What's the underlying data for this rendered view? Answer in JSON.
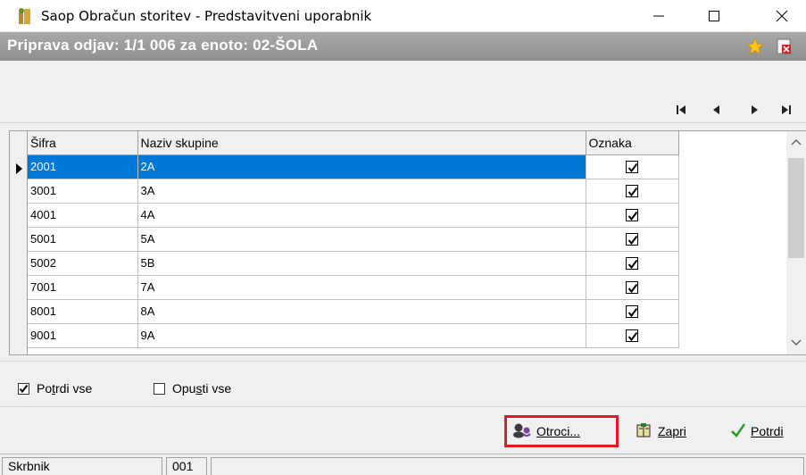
{
  "window": {
    "title": "Saop Obračun storitev - Predstavitveni uporabnik",
    "minimize_icon": "minimize-icon",
    "maximize_icon": "maximize-icon",
    "close_icon": "close-icon"
  },
  "header": {
    "title": "Priprava odjav: 1/1 006 za enoto: 02-ŠOLA",
    "favorite_icon": "star-icon",
    "exit_icon": "exit-icon"
  },
  "nav": {
    "first_icon": "first-record-icon",
    "prev_icon": "previous-record-icon",
    "next_icon": "next-record-icon",
    "last_icon": "last-record-icon"
  },
  "grid": {
    "columns": [
      "Šifra",
      "Naziv skupine",
      "Oznaka"
    ],
    "rows": [
      {
        "sifra": "2001",
        "naziv": "2A",
        "oznaka": true,
        "selected": true
      },
      {
        "sifra": "3001",
        "naziv": "3A",
        "oznaka": true
      },
      {
        "sifra": "4001",
        "naziv": "4A",
        "oznaka": true
      },
      {
        "sifra": "5001",
        "naziv": "5A",
        "oznaka": true
      },
      {
        "sifra": "5002",
        "naziv": "5B",
        "oznaka": true
      },
      {
        "sifra": "7001",
        "naziv": "7A",
        "oznaka": true
      },
      {
        "sifra": "8001",
        "naziv": "8A",
        "oznaka": true
      },
      {
        "sifra": "9001",
        "naziv": "9A",
        "oznaka": true
      }
    ]
  },
  "options": {
    "potrdi_vse": {
      "pre": "Po",
      "acc": "t",
      "post": "rdi vse",
      "checked": true
    },
    "opusti_vse": {
      "pre": "Opu",
      "acc": "s",
      "post": "ti vse",
      "checked": false
    }
  },
  "buttons": {
    "otroci": "Otroci...",
    "zapri": "Zapri",
    "potrdi": "Potrdi"
  },
  "statusbar": {
    "cell1": "Skrbnik",
    "cell2": "001",
    "cell3": ""
  },
  "colors": {
    "selection": "#0078d7",
    "highlight": "#e11b22",
    "header_bg": "#999999"
  }
}
